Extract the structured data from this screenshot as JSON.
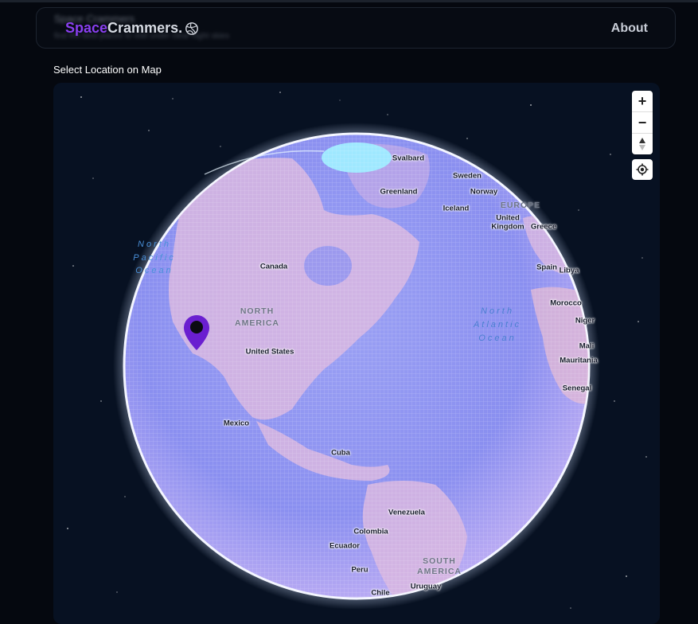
{
  "navbar": {
    "brand_part1": "Space",
    "brand_part2": "Crammers.",
    "brand_icon": "globe-icon",
    "about_label": "About"
  },
  "section": {
    "label": "Select Location on Map"
  },
  "map": {
    "controls": {
      "zoom_in": "+",
      "zoom_out": "−",
      "compass_icon": "compass-icon",
      "geolocate_icon": "geolocate-icon"
    },
    "marker_icon": "map-pin-icon",
    "marker_color": "#6a1fd0",
    "labels": {
      "svalbard": "Svalbard",
      "sweden": "Sweden",
      "greenland": "Greenland",
      "norway": "Norway",
      "iceland": "Iceland",
      "europe": "EUROPE",
      "uk_line1": "United",
      "uk_line2": "Kingdom",
      "greece": "Greece",
      "canada": "Canada",
      "spain": "Spain",
      "libya": "Libya",
      "north_pacific_1": "North",
      "north_pacific_2": "Pacific",
      "north_pacific_3": "Ocean",
      "north_america_1": "NORTH",
      "north_america_2": "AMERICA",
      "morocco": "Morocco",
      "north_atlantic_1": "North",
      "north_atlantic_2": "Atlantic",
      "north_atlantic_3": "Ocean",
      "niger": "Niger",
      "united_states": "United States",
      "mali": "Mali",
      "mauritania": "Mauritania",
      "senegal": "Senegal",
      "mexico": "Mexico",
      "cuba": "Cuba",
      "venezuela": "Venezuela",
      "colombia": "Colombia",
      "ecuador": "Ecuador",
      "peru": "Peru",
      "south_america_1": "SOUTH",
      "south_america_2": "AMERICA",
      "uruguay": "Uruguay",
      "chile": "Chile"
    }
  },
  "colors": {
    "brand_accent": "#8a3ff0",
    "background": "#05080f",
    "globe_ocean": "#8f93f0",
    "globe_land": "#d6b3df"
  }
}
